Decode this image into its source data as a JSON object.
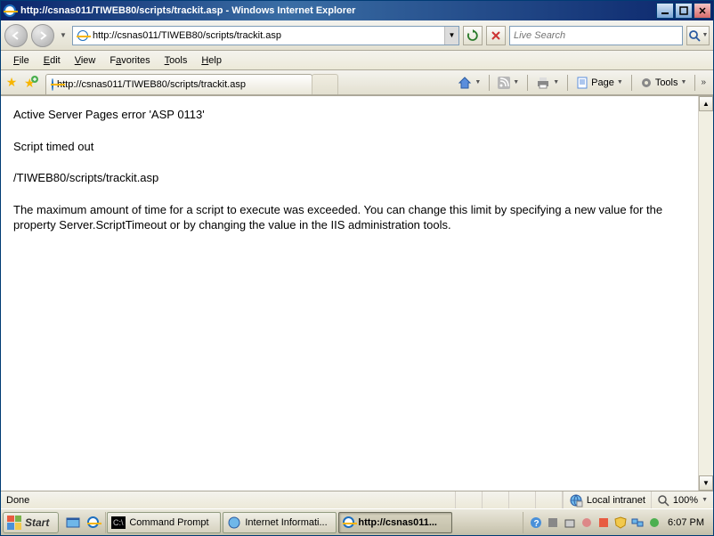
{
  "titlebar": {
    "title": "http://csnas011/TIWEB80/scripts/trackit.asp - Windows Internet Explorer"
  },
  "navbar": {
    "url": "http://csnas011/TIWEB80/scripts/trackit.asp",
    "search_placeholder": "Live Search"
  },
  "menubar": {
    "file": "File",
    "edit": "Edit",
    "view": "View",
    "favorites": "Favorites",
    "tools": "Tools",
    "help": "Help"
  },
  "tab": {
    "title": "http://csnas011/TIWEB80/scripts/trackit.asp"
  },
  "cmdbar": {
    "page": "Page",
    "tools": "Tools"
  },
  "page": {
    "line1": "Active Server Pages error 'ASP 0113'",
    "line2": "Script timed out",
    "line3": "/TIWEB80/scripts/trackit.asp",
    "line4": "The maximum amount of time for a script to execute was exceeded. You can change this limit by specifying a new value for the property Server.ScriptTimeout or by changing the value in the IIS administration tools."
  },
  "statusbar": {
    "status": "Done",
    "zone": "Local intranet",
    "zoom": "100%"
  },
  "taskbar": {
    "start": "Start",
    "tasks": [
      "Command Prompt",
      "Internet Informati...",
      "http://csnas011..."
    ],
    "clock": "6:07 PM"
  }
}
